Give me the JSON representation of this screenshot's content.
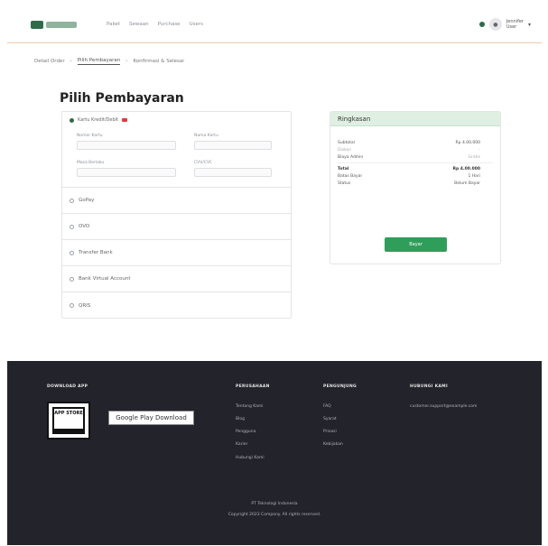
{
  "header": {
    "nav": [
      "Paket",
      "Sewaan",
      "Purchase",
      "Users"
    ],
    "user_name": "Jennifer",
    "user_sub": "User"
  },
  "breadcrumb": [
    "Detail Order",
    "Pilih Pembayaran",
    "Konfirmasi & Selesai"
  ],
  "page_title": "Pilih Pembayaran",
  "payment": {
    "card_option": "Kartu Kredit/Debit",
    "fields": {
      "card_number": "Nomor Kartu",
      "name": "Nama Kartu",
      "expiry": "Masa Berlaku",
      "cvv": "CVV/CVC"
    },
    "options": [
      "GoPay",
      "OVO",
      "Transfer Bank",
      "Bank Virtual Account",
      "QRIS"
    ]
  },
  "summary": {
    "title": "Ringkasan",
    "rows": [
      {
        "label": "Subtotal",
        "value": "Rp 4.00.000",
        "muted": false
      },
      {
        "label": "Diskon",
        "value": "-",
        "muted": true
      },
      {
        "label": "Biaya Admin",
        "value": "Gratis",
        "muted": true
      }
    ],
    "totals": [
      {
        "label": "Total",
        "value": "Rp 4.00.000",
        "bold": true
      },
      {
        "label": "Batas Bayar",
        "value": "1 Hari",
        "bold": false
      },
      {
        "label": "Status",
        "value": "Belum Bayar",
        "bold": false
      }
    ],
    "button": "Bayar"
  },
  "footer": {
    "download_title": "DOWNLOAD APP",
    "badge_text": "APP STORE",
    "google_play": "Google Play Download",
    "cols": [
      {
        "title": "PERUSAHAAN",
        "links": [
          "Tentang Kami",
          "Blog",
          "Pengguna",
          "Karier",
          "Hubungi Kami"
        ]
      },
      {
        "title": "PENGUNJUNG",
        "links": [
          "FAQ",
          "Syarat",
          "Privasi",
          "Kebijakan"
        ]
      },
      {
        "title": "HUBUNGI KAMI",
        "links": [
          "customer.support@example.com"
        ]
      }
    ],
    "company": "PT Teknologi Indonesia",
    "copyright": "Copyright 2023 Company. All rights reserved."
  }
}
